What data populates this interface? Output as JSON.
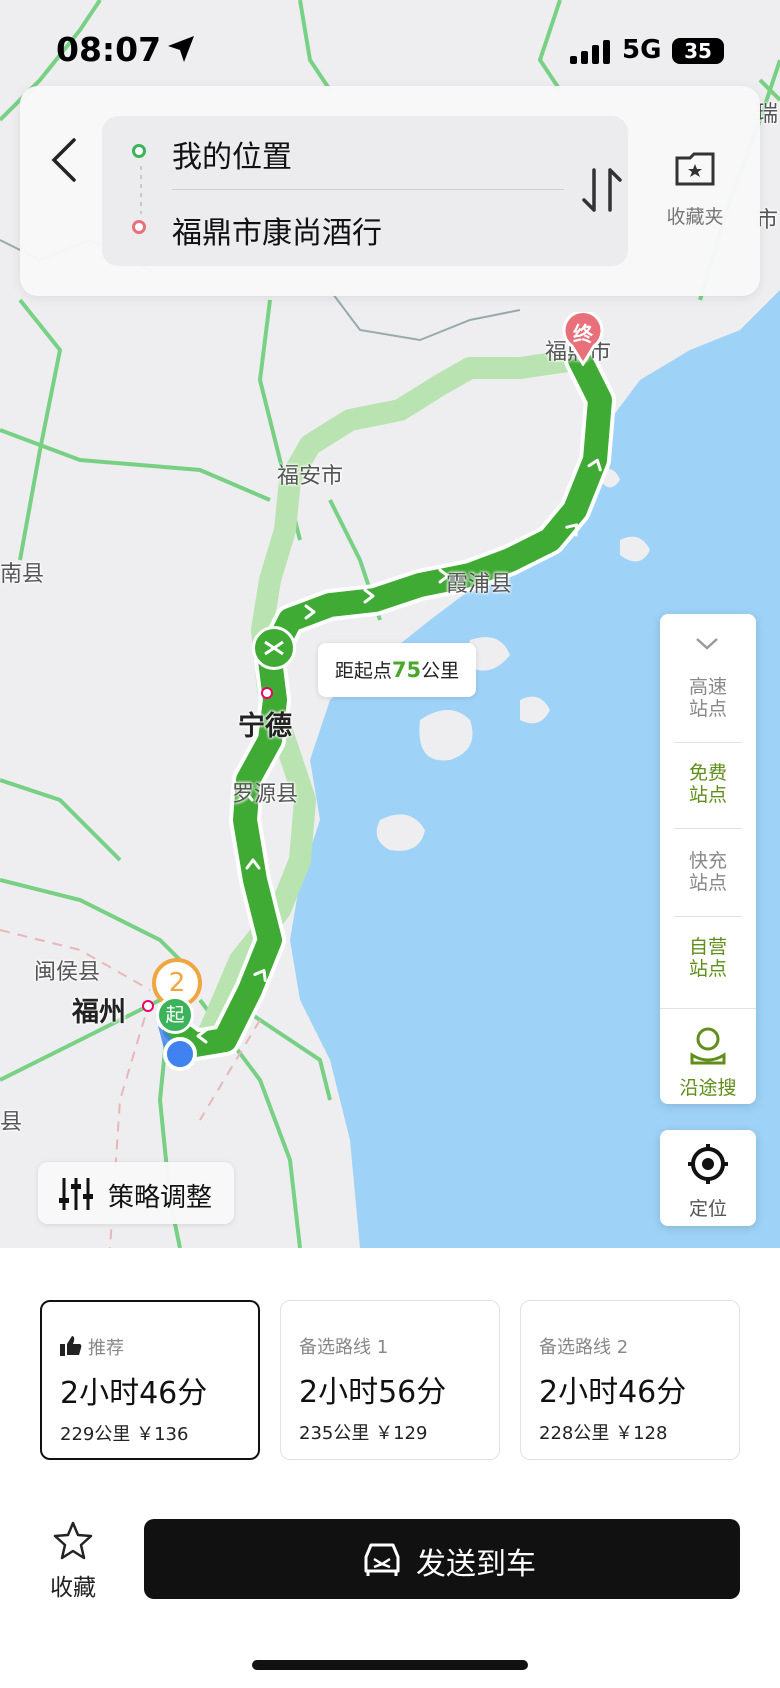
{
  "status": {
    "time": "08:07",
    "network": "5G",
    "battery": "35"
  },
  "search": {
    "from": "我的位置",
    "to": "福鼎市康尚酒行",
    "favorites_label": "收藏夹"
  },
  "map": {
    "labels": {
      "fuding": "福鼎市",
      "fuan": "福安市",
      "xiapu": "霞浦县",
      "ningde": "宁德",
      "luoyuan": "罗源县",
      "minhou": "闽侯县",
      "fuzhou": "福州",
      "nan_county": "南县",
      "county_edge": "县",
      "edge_top_right_1": "瑞",
      "edge_top_right_2": "市"
    },
    "markers": {
      "start": "起",
      "end": "终",
      "waypoint_count": "2"
    },
    "distance_bubble": {
      "prefix": "距起点",
      "value": "75",
      "unit": "公里"
    }
  },
  "side_panel": {
    "items": [
      "高速站点",
      "免费站点",
      "快充站点",
      "自营站点"
    ],
    "search_along": "沿途搜"
  },
  "locate_label": "定位",
  "strategy_label": "策略调整",
  "routes": [
    {
      "tag": "推荐",
      "duration": "2小时46分",
      "meta": "229公里 ￥136"
    },
    {
      "tag": "备选路线 1",
      "duration": "2小时56分",
      "meta": "235公里 ￥129"
    },
    {
      "tag": "备选路线 2",
      "duration": "2小时46分",
      "meta": "228公里 ￥128"
    }
  ],
  "actions": {
    "collect": "收藏",
    "send_to_car": "发送到车"
  },
  "colors": {
    "route_green": "#3faa34",
    "alt_route": "#b9e3b0",
    "water": "#9ed3f7",
    "accent_green": "#5f8e1b"
  }
}
